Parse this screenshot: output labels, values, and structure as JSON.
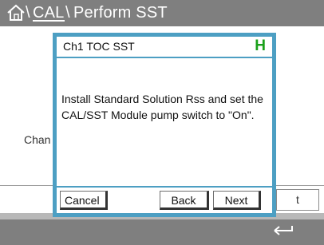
{
  "header": {
    "sep1": "\\",
    "menu": "CAL",
    "sep2": "\\",
    "title": "Perform SST"
  },
  "background": {
    "truncated_label": "Chan",
    "truncated_button": "t"
  },
  "dialog": {
    "title": "Ch1 TOC SST",
    "status_indicator": "H",
    "message": "Install Standard Solution Rss and set the CAL/SST Module pump switch to \"On\".",
    "buttons": {
      "cancel": "Cancel",
      "back": "Back",
      "next": "Next"
    }
  },
  "colors": {
    "header_bg": "#7f7f7f",
    "dialog_border": "#4d9fc3",
    "status_green": "#1aa01a"
  },
  "icons": {
    "home": "home-icon",
    "back": "return-arrow-icon"
  }
}
